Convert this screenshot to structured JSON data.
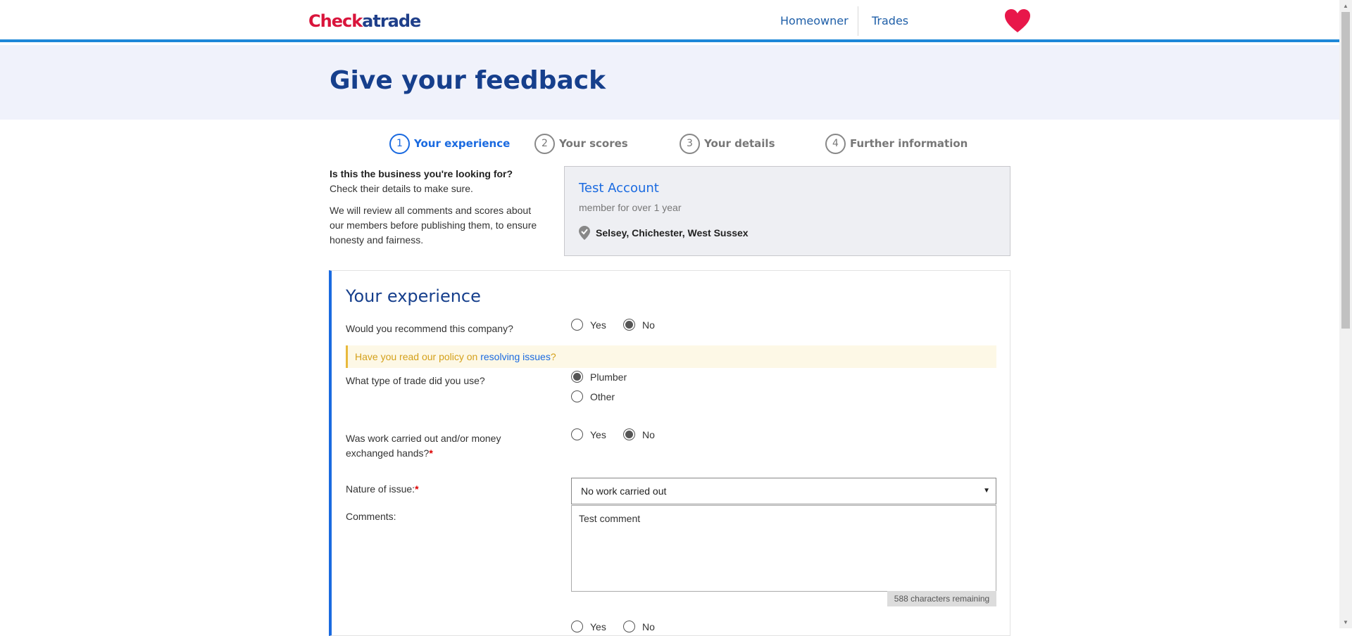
{
  "header": {
    "logo_part1": "Check",
    "logo_part2": "atrade",
    "nav": [
      "Homeowner",
      "Trades"
    ],
    "heart_color": "#e8174a"
  },
  "hero": {
    "title": "Give your feedback"
  },
  "steps": [
    {
      "num": "1",
      "label": "Your experience",
      "active": true
    },
    {
      "num": "2",
      "label": "Your scores",
      "active": false
    },
    {
      "num": "3",
      "label": "Your details",
      "active": false
    },
    {
      "num": "4",
      "label": "Further information",
      "active": false
    }
  ],
  "intro": {
    "question": "Is this the business you're looking for?",
    "hint": "Check their details to make sure.",
    "note": "We will review all comments and scores about our members before publishing them, to ensure honesty and fairness."
  },
  "business": {
    "name": "Test Account",
    "member": "member for over 1 year",
    "location": "Selsey, Chichester, West Sussex"
  },
  "form": {
    "title": "Your experience",
    "recommend": {
      "label": "Would you recommend this company?",
      "options": [
        "Yes",
        "No"
      ],
      "selected": "No"
    },
    "notice_prefix": "Have you read our policy on ",
    "notice_link": "resolving issues",
    "notice_suffix": "?",
    "trade": {
      "label": "What type of trade did you use?",
      "options": [
        "Plumber",
        "Other"
      ],
      "selected": "Plumber"
    },
    "work": {
      "label": "Was work carried out and/or money exchanged hands?",
      "required": "*",
      "options": [
        "Yes",
        "No"
      ],
      "selected": "No"
    },
    "issue": {
      "label": "Nature of issue:",
      "required": "*",
      "value": "No work carried out",
      "caret": "▼"
    },
    "comments": {
      "label": "Comments:",
      "value": "Test comment",
      "remaining": "588 characters remaining"
    },
    "next_options": [
      "Yes",
      "No"
    ]
  },
  "colors": {
    "accent": "#1a6ae0",
    "heading": "#163f8c",
    "brand_red": "#d9143b",
    "topbar_border": "#1e88d8"
  }
}
